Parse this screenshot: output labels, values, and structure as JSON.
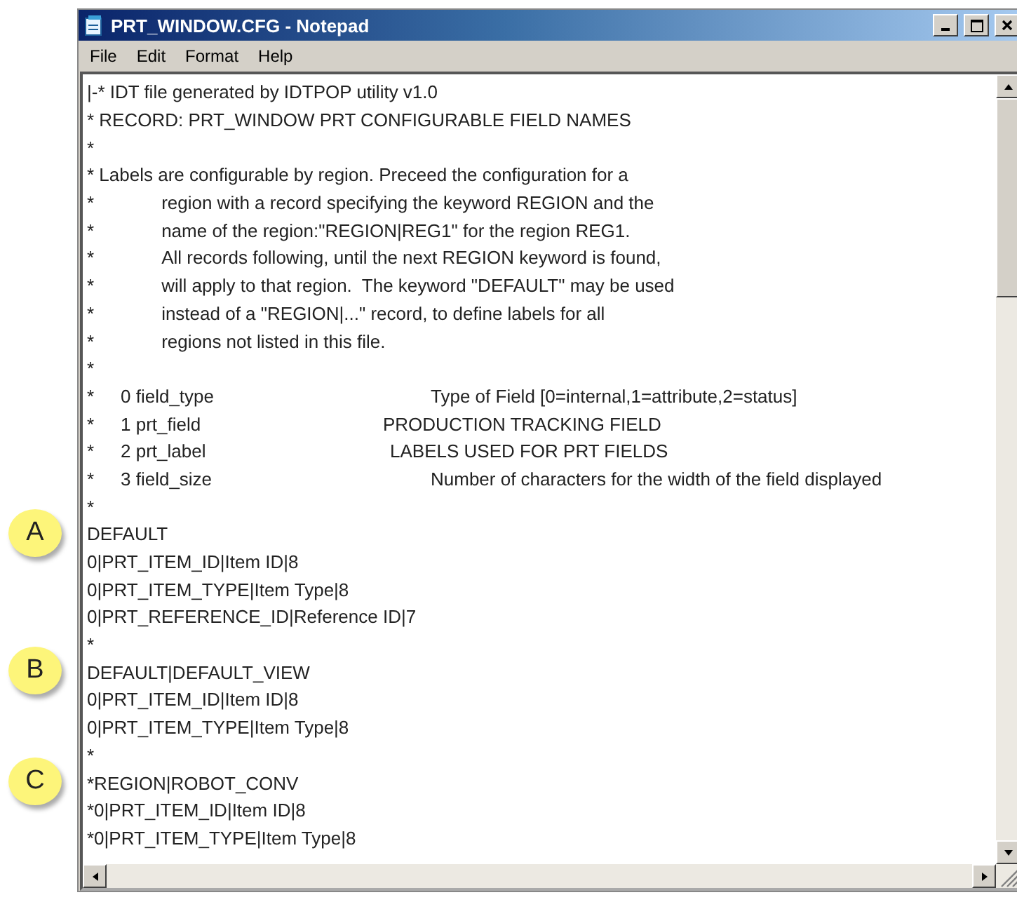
{
  "window": {
    "title": "PRT_WINDOW.CFG - Notepad"
  },
  "menu": [
    "File",
    "Edit",
    "Format",
    "Help"
  ],
  "lines": [
    {
      "kind": "text",
      "text": "|-* IDT file generated by IDTPOP utility v1.0"
    },
    {
      "kind": "text",
      "text": "* RECORD: PRT_WINDOW PRT CONFIGURABLE FIELD NAMES"
    },
    {
      "kind": "text",
      "text": "*"
    },
    {
      "kind": "text",
      "text": "* Labels are configurable by region. Preceed the configuration for a"
    },
    {
      "kind": "continued",
      "marker": "*",
      "text": "region with a record specifying the keyword REGION and the"
    },
    {
      "kind": "continued",
      "marker": "*",
      "text": "name of the region:\"REGION|REG1\" for the region REG1."
    },
    {
      "kind": "continued",
      "marker": "*",
      "text": "All records following, until the next REGION keyword is found,"
    },
    {
      "kind": "continued",
      "marker": "*",
      "text": "will apply to that region.  The keyword \"DEFAULT\" may be used"
    },
    {
      "kind": "continued",
      "marker": "*",
      "text": "instead of a \"REGION|...\" record, to define labels for all"
    },
    {
      "kind": "continued",
      "marker": "*",
      "text": "regions not listed in this file."
    },
    {
      "kind": "text",
      "text": "*"
    },
    {
      "kind": "field",
      "marker": "*",
      "name": "0 field_type",
      "description": "Type of Field [0=internal,1=attribute,2=status]"
    },
    {
      "kind": "field",
      "marker": "*",
      "name": "1 prt_field",
      "description": "PRODUCTION TRACKING FIELD"
    },
    {
      "kind": "field",
      "marker": "*",
      "name": "2 prt_label",
      "description": "LABELS USED FOR PRT FIELDS"
    },
    {
      "kind": "field",
      "marker": "*",
      "name": "3 field_size",
      "description": "Number of characters for the width of the field displayed"
    },
    {
      "kind": "text",
      "text": "*"
    },
    {
      "kind": "text",
      "text": "DEFAULT",
      "callout": "A"
    },
    {
      "kind": "text",
      "text": "0|PRT_ITEM_ID|Item ID|8"
    },
    {
      "kind": "text",
      "text": "0|PRT_ITEM_TYPE|Item Type|8"
    },
    {
      "kind": "text",
      "text": "0|PRT_REFERENCE_ID|Reference ID|7"
    },
    {
      "kind": "text",
      "text": "*"
    },
    {
      "kind": "text",
      "text": "DEFAULT|DEFAULT_VIEW",
      "callout": "B"
    },
    {
      "kind": "text",
      "text": "0|PRT_ITEM_ID|Item ID|8"
    },
    {
      "kind": "text",
      "text": "0|PRT_ITEM_TYPE|Item Type|8"
    },
    {
      "kind": "text",
      "text": "*"
    },
    {
      "kind": "text",
      "text": "*REGION|ROBOT_CONV",
      "callout": "C"
    },
    {
      "kind": "text",
      "text": "*0|PRT_ITEM_ID|Item ID|8"
    },
    {
      "kind": "text",
      "text": "*0|PRT_ITEM_TYPE|Item Type|8"
    }
  ]
}
